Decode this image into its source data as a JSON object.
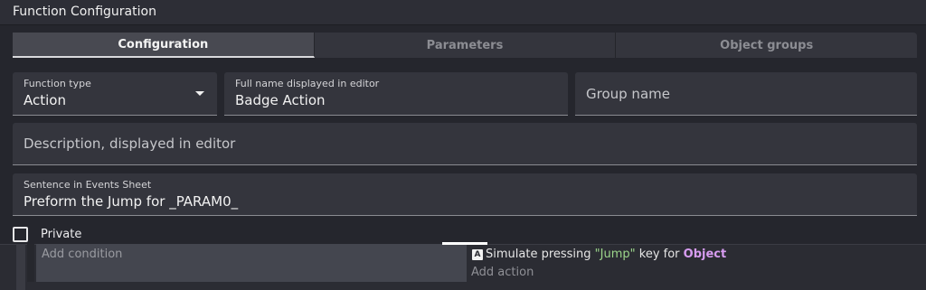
{
  "window": {
    "title": "Function Configuration"
  },
  "tabs": [
    {
      "label": "Configuration",
      "active": true
    },
    {
      "label": "Parameters",
      "active": false
    },
    {
      "label": "Object groups",
      "active": false
    }
  ],
  "fields": {
    "function_type": {
      "label": "Function type",
      "value": "Action"
    },
    "full_name": {
      "label": "Full name displayed in editor",
      "value": "Badge Action"
    },
    "group_name": {
      "placeholder": "Group name"
    },
    "description": {
      "placeholder": "Description, displayed in editor"
    },
    "sentence": {
      "label": "Sentence in Events Sheet",
      "value": "Preform the Jump for _PARAM0_"
    }
  },
  "private": {
    "label": "Private",
    "checked": false
  },
  "events": {
    "add_condition": "Add condition",
    "action": {
      "icon": "keyboard-icon",
      "prefix": "Simulate pressing ",
      "key": "\"Jump\"",
      "middle": " key for ",
      "object": "Object"
    },
    "add_action": "Add action"
  },
  "colors": {
    "background": "#25262d",
    "field_bg": "#34353d",
    "active_tab": "#484951",
    "string_green": "#9cd68b",
    "object_purple": "#d79cf0"
  }
}
